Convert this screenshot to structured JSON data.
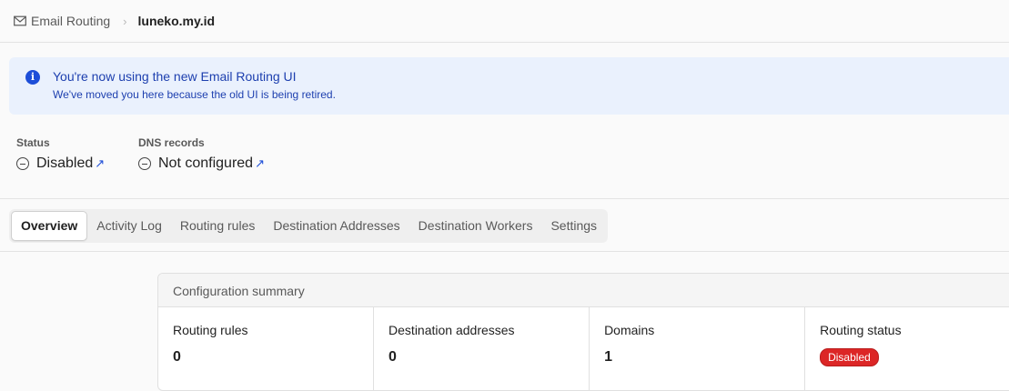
{
  "breadcrumb": {
    "root_label": "Email Routing",
    "root_icon": "envelope-icon",
    "separator": "›",
    "current": "luneko.my.id"
  },
  "banner": {
    "icon": "info-icon",
    "icon_glyph": "i",
    "title": "You're now using the new Email Routing UI",
    "description": "We've moved you here because the old UI is being retired."
  },
  "status": {
    "label": "Status",
    "value": "Disabled",
    "icon": "minus-circle-icon",
    "link_icon": "↗"
  },
  "dns": {
    "label": "DNS records",
    "value": "Not configured",
    "icon": "minus-circle-icon",
    "link_icon": "↗"
  },
  "tabs": [
    {
      "label": "Overview",
      "active": true
    },
    {
      "label": "Activity Log"
    },
    {
      "label": "Routing rules"
    },
    {
      "label": "Destination Addresses"
    },
    {
      "label": "Destination Workers"
    },
    {
      "label": "Settings"
    }
  ],
  "summary": {
    "title": "Configuration summary",
    "routing_rules": {
      "label": "Routing rules",
      "value": "0"
    },
    "destination_addresses": {
      "label": "Destination addresses",
      "value": "0"
    },
    "domains": {
      "label": "Domains",
      "value": "1"
    },
    "routing_status": {
      "label": "Routing status",
      "value": "Disabled",
      "badge_color": "#dc2626"
    }
  },
  "colors": {
    "accent": "#1d4ed8",
    "banner_bg": "#eaf1fd",
    "danger": "#dc2626"
  }
}
